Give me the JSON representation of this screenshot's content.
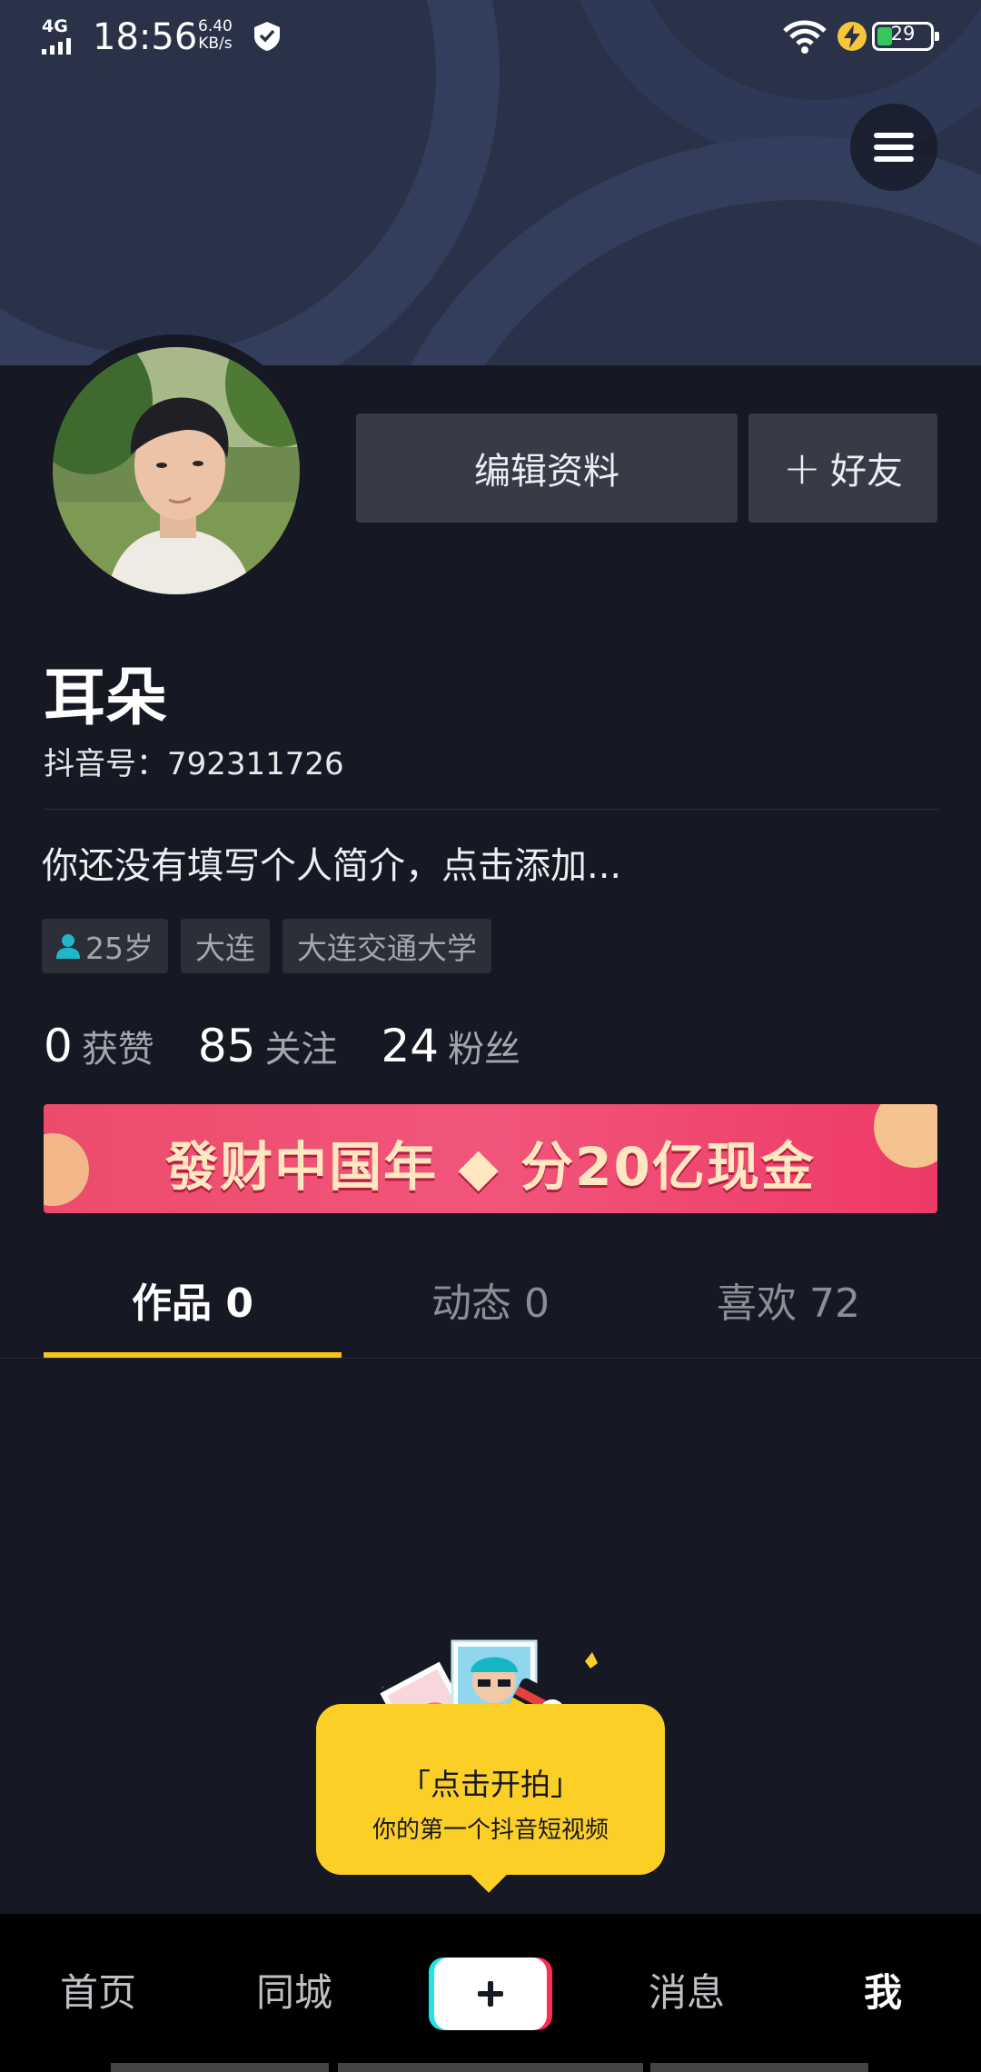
{
  "status_bar": {
    "network": "4G",
    "time": "18:56",
    "speed_value": "6.40",
    "speed_unit": "KB/s",
    "battery": "29",
    "battery_level": 0.29
  },
  "header": {
    "menu_icon": "hamburger-menu-icon"
  },
  "profile": {
    "avatar_icon": "user-avatar-photo",
    "edit_button": "编辑资料",
    "add_friend_plus": "+",
    "add_friend_label": "好友",
    "name": "耳朵",
    "douyin_id_label": "抖音号：792311726",
    "bio": "你还没有填写个人简介，点击添加...",
    "tags": {
      "age": "25岁",
      "city": "大连",
      "school": "大连交通大学"
    },
    "stats": {
      "likes_count": "0",
      "likes_label": "获赞",
      "following_count": "85",
      "following_label": "关注",
      "followers_count": "24",
      "followers_label": "粉丝"
    }
  },
  "banner": {
    "text": "發财中国年 ◆ 分20亿现金"
  },
  "tabs": {
    "works": "作品 0",
    "moments": "动态 0",
    "likes": "喜欢 72"
  },
  "tooltip": {
    "line1": "「点击开拍」",
    "line2": "你的第一个抖音短视频"
  },
  "bottom_nav": {
    "home": "首页",
    "local": "同城",
    "add_icon": "plus-icon",
    "messages": "消息",
    "me": "我"
  },
  "colors": {
    "background": "#161823",
    "accent_yellow": "#f5c518",
    "banner_pink": "#ec4c6c",
    "button_gray": "#383a45"
  }
}
